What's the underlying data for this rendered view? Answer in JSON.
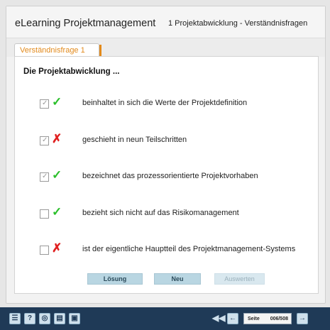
{
  "header": {
    "app_title": "eLearning Projektmanagement",
    "chapter_title": "1 Projektabwicklung - Verständnisfragen"
  },
  "tab": {
    "label": "Verständnisfrage 1",
    "accent_color": "#e28a1c"
  },
  "question": {
    "title": "Die Projektabwicklung ...",
    "answers": [
      {
        "text": "beinhaltet in sich die Werte der Projektdefinition",
        "checked": true,
        "result": "correct"
      },
      {
        "text": "geschieht in neun Teilschritten",
        "checked": true,
        "result": "wrong"
      },
      {
        "text": "bezeichnet das prozessorientierte Projektvorhaben",
        "checked": true,
        "result": "correct"
      },
      {
        "text": "bezieht sich nicht auf das Risikomanagement",
        "checked": false,
        "result": "correct"
      },
      {
        "text": "ist der eigentliche Hauptteil des Projektmanagement-Systems",
        "checked": false,
        "result": "wrong"
      }
    ]
  },
  "buttons": {
    "solution": "Lösung",
    "new": "Neu",
    "evaluate": "Auswerten"
  },
  "toolbar": {
    "icons": [
      "list-icon",
      "help-icon",
      "glossary-icon",
      "notes-icon",
      "print-icon"
    ],
    "page_label": "Seite",
    "page_number": "006/508",
    "bar_color": "#1f3a57"
  }
}
